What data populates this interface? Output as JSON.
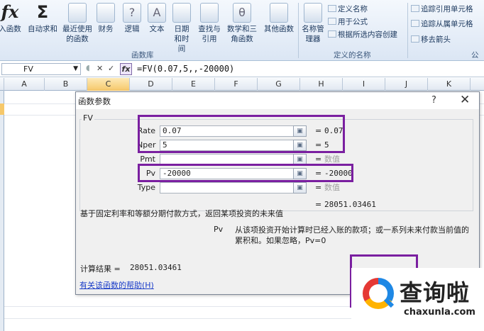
{
  "ribbon": {
    "buttons": [
      {
        "name": "insert-function-button",
        "label": "入函数",
        "icon": "fx-icon"
      },
      {
        "name": "autosum-button",
        "label": "自动求和",
        "icon": "sigma-icon"
      },
      {
        "name": "recently-used-button",
        "label": "最近使用的函数",
        "icon": "book-icon"
      },
      {
        "name": "financial-button",
        "label": "财务",
        "icon": "book-icon"
      },
      {
        "name": "logical-button",
        "label": "逻辑",
        "icon": "question-book-icon"
      },
      {
        "name": "text-button",
        "label": "文本",
        "icon": "text-book-icon"
      },
      {
        "name": "datetime-button",
        "label": "日期和时间",
        "icon": "clock-book-icon"
      },
      {
        "name": "lookup-button",
        "label": "查找与引用",
        "icon": "magnifier-book-icon"
      },
      {
        "name": "math-button",
        "label": "数学和三角函数",
        "icon": "theta-book-icon"
      },
      {
        "name": "more-functions-button",
        "label": "其他函数",
        "icon": "books-icon"
      },
      {
        "name": "name-manager-button",
        "label": "名称管理器",
        "icon": "name-manager-icon"
      }
    ],
    "glyphs": {
      "fx": "fx",
      "sigma": "Σ",
      "logical": "?",
      "text": "A",
      "math": "θ"
    },
    "defined_names": {
      "define_name": "定义名称",
      "use_in_formula": "用于公式",
      "create_from_selection": "根据所选内容创建"
    },
    "auditing": {
      "trace_precedents": "追踪引用单元格",
      "trace_dependents": "追踪从属单元格",
      "remove_arrows": "移去箭头"
    },
    "group_labels": {
      "function_library": "函数库",
      "defined_names": "定义的名称",
      "formula_auditing": "公式"
    }
  },
  "formula_bar": {
    "name_box": "FV",
    "formula": "=FV(0.07,5,,-20000)",
    "fx_glyph": "fx"
  },
  "columns": [
    "A",
    "B",
    "C",
    "D",
    "E",
    "F",
    "G",
    "H",
    "I",
    "J",
    "K"
  ],
  "selected_column": "C",
  "dialog": {
    "title": "函数参数",
    "help_glyph": "?",
    "close_glyph": "✕",
    "function_name": "FV",
    "args": [
      {
        "label": "Rate",
        "value": "0.07",
        "result": "0.07"
      },
      {
        "label": "Nper",
        "value": "5",
        "result": "5"
      },
      {
        "label": "Pmt",
        "value": "",
        "result": "数值"
      },
      {
        "label": "Pv",
        "value": "-20000",
        "result": "-20000"
      },
      {
        "label": "Type",
        "value": "",
        "result": "数值"
      }
    ],
    "formula_result_preview": "28051.03461",
    "description": "基于固定利率和等额分期付款方式，返回某项投资的未来值",
    "arg_help_name": "Pv",
    "arg_help_text": "从该项投资开始计算时已经入账的款项；或一系列未来付款当前值的累积和。如果忽略，Pv=0",
    "result_label": "计算结果 =",
    "result_value": "28051.03461",
    "help_link": "有关该函数的帮助(H)"
  },
  "watermark": {
    "cn": "查询啦",
    "en": "chaxunla.com"
  }
}
